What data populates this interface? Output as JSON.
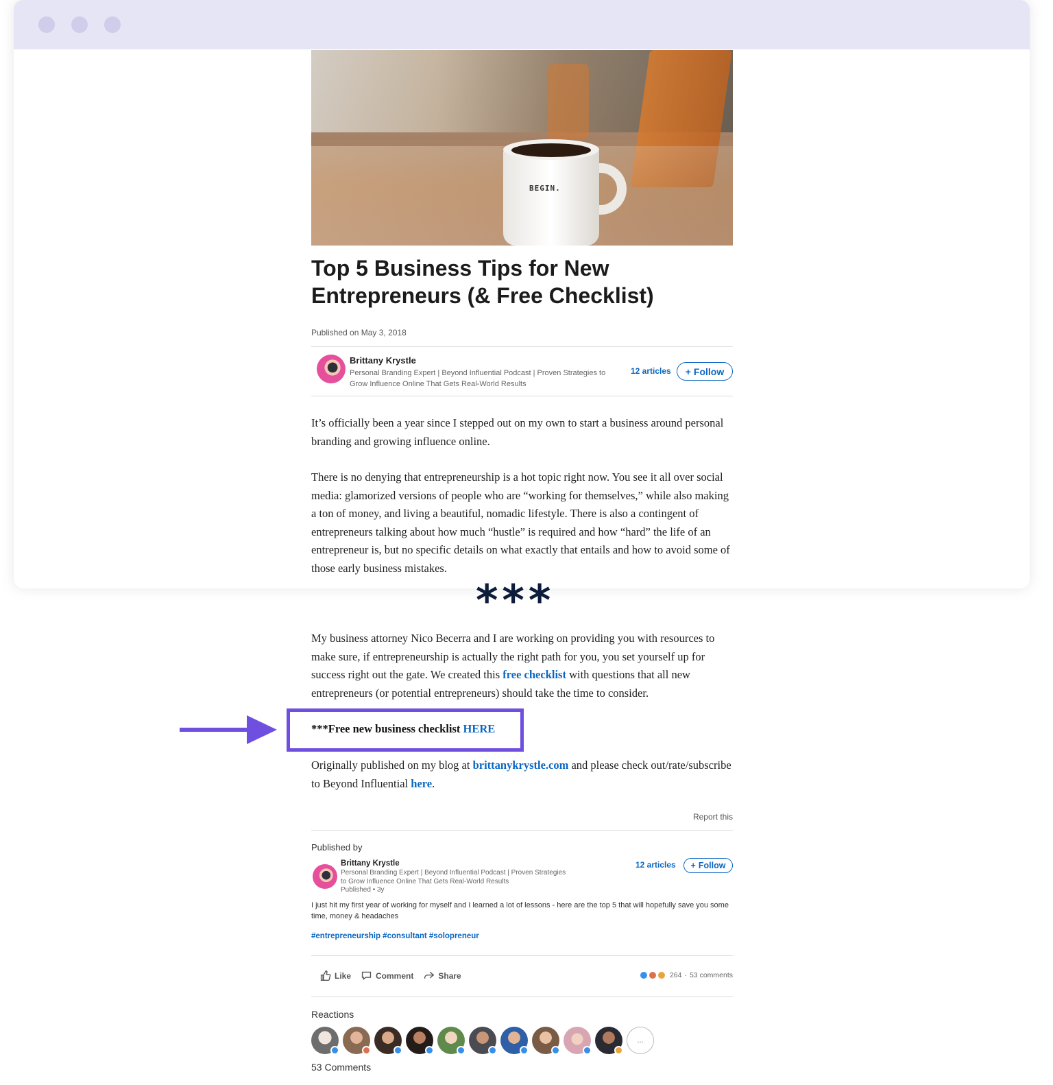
{
  "colors": {
    "accent": "#6f4fe0",
    "link": "#0a66c2",
    "titlebar": "#e5e5f5"
  },
  "article": {
    "hero_image": {
      "mug_text": "BEGIN."
    },
    "title": "Top 5 Business Tips for New Entrepreneurs (& Free Checklist)",
    "published_date": "Published on May 3, 2018",
    "author": {
      "name": "Brittany Krystle",
      "headline_line1": "Personal Branding Expert | Beyond Influential Podcast | Proven Strategies to",
      "headline_line2": "Grow Influence Online That Gets Real-World Results",
      "articles_link": "12 articles",
      "follow_label": "Follow"
    },
    "paragraph1": "It’s officially been a year since I stepped out on my own to start a business around personal branding and growing influence online.",
    "paragraph2": "There is no denying that entrepreneurship is a hot topic right now. You see it all over social media: glamorized versions of people who are “working for themselves,” while also making a ton of money, and living a beautiful, nomadic lifestyle. There is also a contingent of entrepreneurs talking about how much “hustle” is required and how “hard” the life of an entrepreneur is, but no specific details on what exactly that entails and how to avoid some of those early business mistakes.",
    "divider_stars": "***",
    "paragraph3_before": "My business attorney Nico Becerra and I are working on providing you with resources to make sure, if entrepreneurship is actually the right path for you, you set yourself up for success right out the gate. We created this ",
    "paragraph3_link": "free checklist",
    "paragraph3_after": " with questions that all new entrepreneurs (or potential entrepreneurs) should take the time to consider.",
    "checklist_prefix": "***Free new business checklist ",
    "checklist_link": "HERE",
    "paragraph4_before": "Originally published on my blog at ",
    "paragraph4_link": "brittanykrystle.com",
    "paragraph4_middle": " and please check out/rate/subscribe to Beyond Influential ",
    "paragraph4_link2": "here",
    "paragraph4_after": ".",
    "report_label": "Report this"
  },
  "published_by": {
    "label": "Published by",
    "name": "Brittany Krystle",
    "headline_line1": "Personal Branding Expert | Beyond Influential Podcast | Proven Strategies",
    "headline_line2": "to Grow Influence Online That Gets Real-World Results",
    "published_ago": "Published • 3y",
    "articles_link": "12 articles",
    "follow_label": "Follow",
    "snippet": "I just hit my first year of working for myself and I learned a lot of lessons - here are the top 5 that will hopefully save you some time, money & headaches",
    "hashtags": "#entrepreneurship #consultant #solopreneur"
  },
  "social": {
    "like_label": "Like",
    "comment_label": "Comment",
    "share_label": "Share",
    "reaction_count": "264",
    "comments_count": "53 comments",
    "reactions_label": "Reactions",
    "more_label": "...",
    "comments_heading": "53 Comments"
  }
}
